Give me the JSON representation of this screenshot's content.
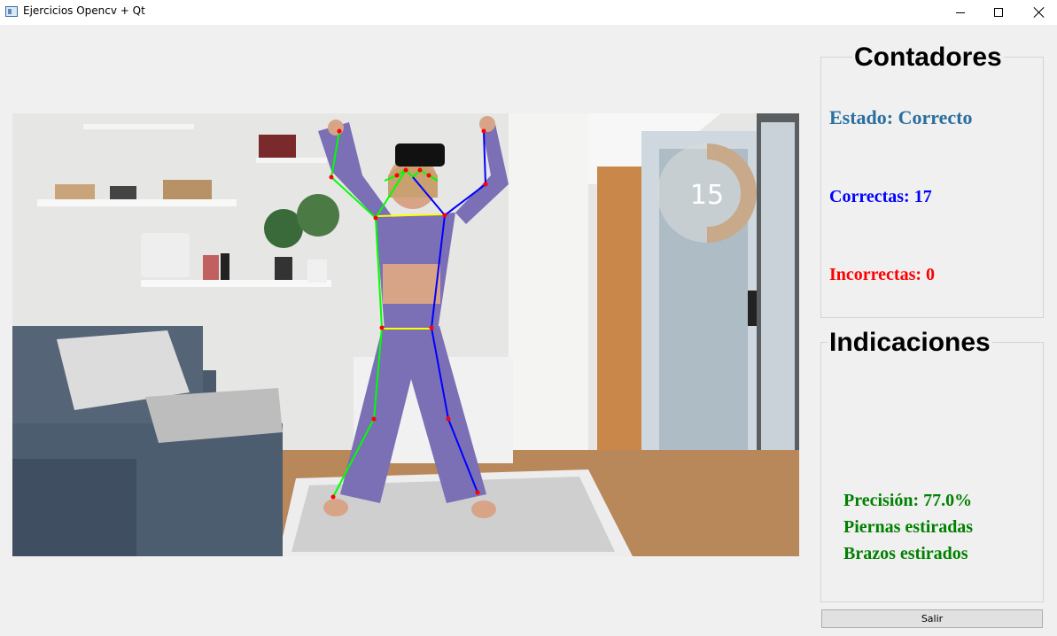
{
  "window": {
    "title": "Ejercicios Opencv + Qt"
  },
  "video": {
    "rep_counter": "15",
    "progress_fraction": 0.5,
    "colors": {
      "left_side": "#00ff00",
      "right_side": "#0000ff",
      "shoulders_hips": "#ffff00",
      "joints": "#ff0000",
      "counter_ring": "#c8a98a"
    }
  },
  "contadores": {
    "title": "Contadores",
    "estado": "Estado: Correcto",
    "correctas": "Correctas: 17",
    "incorrectas": "Incorrectas: 0",
    "colors": {
      "estado": "#2a6f9e",
      "correctas": "#0000ff",
      "incorrectas": "#ff0000"
    }
  },
  "indicaciones": {
    "title": "Indicaciones",
    "precision": "Precisión: 77.0%",
    "piernas": "Piernas estiradas",
    "brazos": "Brazos estirados",
    "color": "#008000"
  },
  "buttons": {
    "salir": "Salir"
  }
}
